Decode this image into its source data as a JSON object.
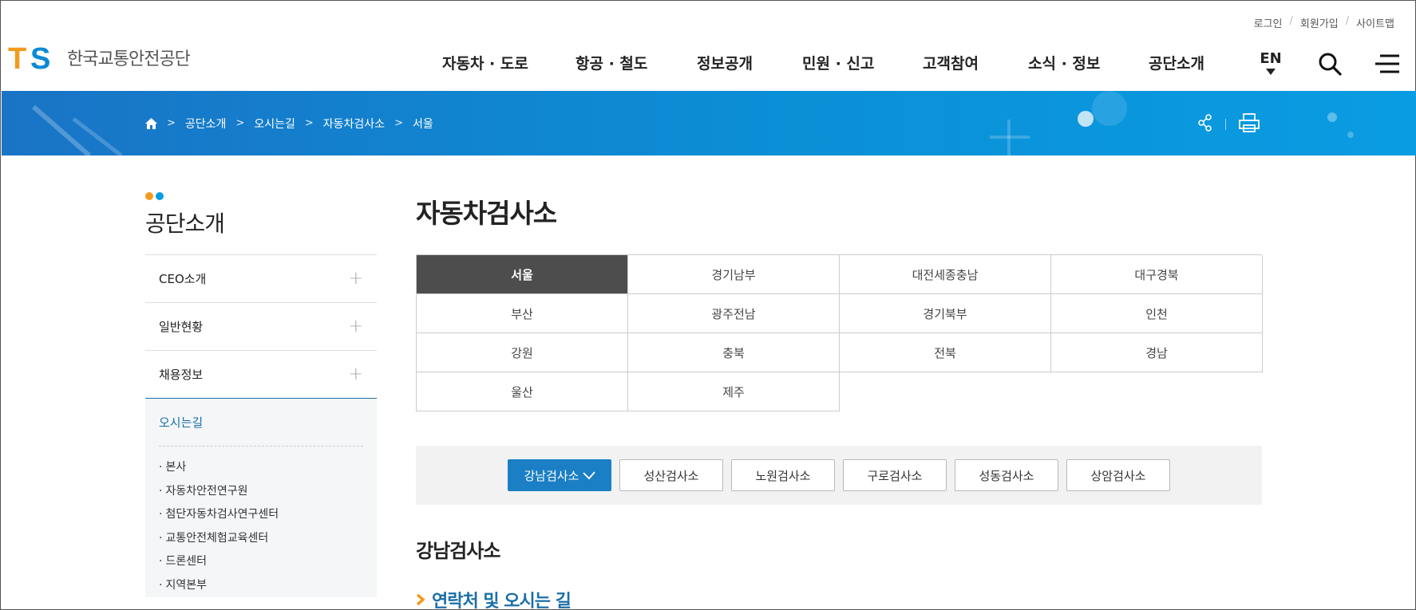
{
  "utility": {
    "login": "로그인",
    "join": "회원가입",
    "sitemap": "사이트맵"
  },
  "logo": {
    "mark_t": "T",
    "mark_s": "S",
    "org_name": "한국교통안전공단",
    "colors": {
      "t": "#f29a1f",
      "s": "#0a8ad4"
    }
  },
  "gnb": [
    "자동차 · 도로",
    "항공 · 철도",
    "정보공개",
    "민원 · 신고",
    "고객참여",
    "소식 · 정보",
    "공단소개"
  ],
  "lang": "EN",
  "icons": {
    "search": "search-icon",
    "menu": "hamburger-menu-icon",
    "home": "home-icon",
    "share": "share-icon",
    "print": "print-icon"
  },
  "breadcrumb": [
    "공단소개",
    "오시는길",
    "자동차검사소",
    "서울"
  ],
  "lnb": {
    "title": "공단소개",
    "items": [
      "CEO소개",
      "일반현황",
      "채용정보"
    ],
    "active": {
      "title": "오시는길",
      "sub": [
        "본사",
        "자동차안전연구원",
        "첨단자동차검사연구센터",
        "교통안전체험교육센터",
        "드론센터",
        "지역본부"
      ]
    },
    "dot_colors": [
      "#f29a1f",
      "#0a9ce2"
    ]
  },
  "content": {
    "title": "자동차검사소",
    "regions": [
      "서울",
      "경기남부",
      "대전세종충남",
      "대구경북",
      "부산",
      "광주전남",
      "경기북부",
      "인천",
      "강원",
      "충북",
      "전북",
      "경남",
      "울산",
      "제주"
    ],
    "active_region": "서울",
    "stations": [
      "강남검사소",
      "성산검사소",
      "노원검사소",
      "구로검사소",
      "성동검사소",
      "상암검사소"
    ],
    "active_station": "강남검사소",
    "station_heading": "강남검사소",
    "section_heading": "연락처 및 오시는 길"
  },
  "colors": {
    "accent": "#1b7fc5",
    "banner": "#0b8fd6",
    "active_region_bg": "#4d4d4d"
  }
}
